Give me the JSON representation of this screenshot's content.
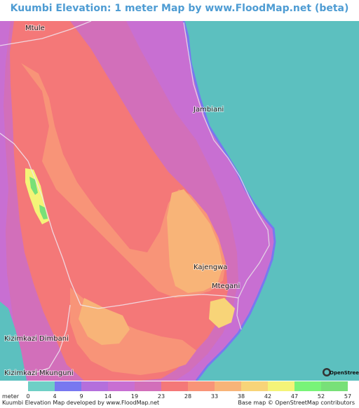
{
  "title": "Kuumbi Elevation: 1 meter Map by www.FloodMap.net (beta)",
  "places": [
    "Mtule",
    "Jambiani",
    "Kajengwa",
    "Mtegani",
    "Kizimkazi Dimbani",
    "Kizimkazi Mkunguni"
  ],
  "osm_logo_text": "OpenStreetMap",
  "legend": {
    "unit": "meter",
    "labels": [
      "0",
      "4",
      "9",
      "14",
      "19",
      "23",
      "28",
      "33",
      "38",
      "42",
      "47",
      "52",
      "57"
    ],
    "colors": [
      "#6fcfc6",
      "#7878f0",
      "#b46fdc",
      "#c86fd2",
      "#d26fba",
      "#f47878",
      "#f89478",
      "#f8b478",
      "#f8d478",
      "#f4f478",
      "#78f478",
      "#78e078"
    ]
  },
  "footer": {
    "left": "Kuumbi Elevation Map developed by www.FloodMap.net",
    "right": "Base map © OpenStreetMap contributors"
  },
  "colors": {
    "sea": "#5cc0bf",
    "title": "#4e9cd3"
  }
}
